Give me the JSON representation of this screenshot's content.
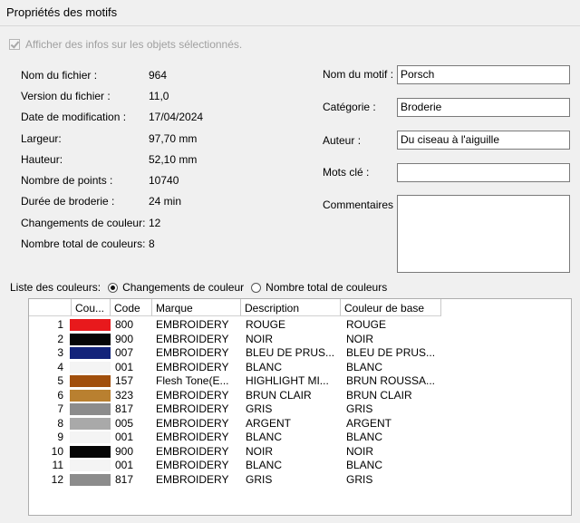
{
  "window": {
    "title": "Propriétés des motifs"
  },
  "show_info_checkbox": {
    "label": "Afficher des infos sur les objets sélectionnés.",
    "checked": true,
    "enabled": false
  },
  "info": [
    {
      "label": "Nom du fichier :",
      "value": "964"
    },
    {
      "label": "Version du fichier :",
      "value": "11,0"
    },
    {
      "label": "Date de modification :",
      "value": "17/04/2024"
    },
    {
      "label": "Largeur:",
      "value": "97,70 mm"
    },
    {
      "label": "Hauteur:",
      "value": "52,10 mm"
    },
    {
      "label": "Nombre de points :",
      "value": "10740"
    },
    {
      "label": "Durée de broderie :",
      "value": "24 min"
    },
    {
      "label": "Changements de couleur:",
      "value": "12"
    },
    {
      "label": "Nombre total de couleurs:",
      "value": "8"
    }
  ],
  "fields": {
    "name": {
      "label": "Nom du motif :",
      "value": "Porsch"
    },
    "category": {
      "label": "Catégorie :",
      "value": "Broderie"
    },
    "author": {
      "label": "Auteur :",
      "value": "Du ciseau à l'aiguille"
    },
    "keywords": {
      "label": "Mots clé :",
      "value": ""
    },
    "comments": {
      "label": "Commentaires :",
      "value": ""
    }
  },
  "color_list": {
    "label": "Liste des couleurs:",
    "option_changes": "Changements de couleur",
    "option_total": "Nombre total de couleurs",
    "selected": "Changements de couleur"
  },
  "table": {
    "headers": [
      "Cou...",
      "Code",
      "Marque",
      "Description",
      "Couleur de base"
    ],
    "rows": [
      {
        "n": "1",
        "color": "#e8191c",
        "code": "800",
        "brand": "EMBROIDERY",
        "desc": "ROUGE",
        "base": "ROUGE"
      },
      {
        "n": "2",
        "color": "#060606",
        "code": "900",
        "brand": "EMBROIDERY",
        "desc": "NOIR",
        "base": "NOIR"
      },
      {
        "n": "3",
        "color": "#13237a",
        "code": "007",
        "brand": "EMBROIDERY",
        "desc": "BLEU DE PRUS...",
        "base": "BLEU DE PRUS..."
      },
      {
        "n": "4",
        "color": "#f4f4f4",
        "code": "001",
        "brand": "EMBROIDERY",
        "desc": "BLANC",
        "base": "BLANC"
      },
      {
        "n": "5",
        "color": "#a14f0c",
        "code": "157",
        "brand": "Flesh Tone(E...",
        "desc": "HIGHLIGHT MI...",
        "base": "BRUN ROUSSA..."
      },
      {
        "n": "6",
        "color": "#b98030",
        "code": "323",
        "brand": "EMBROIDERY",
        "desc": "BRUN CLAIR",
        "base": "BRUN CLAIR"
      },
      {
        "n": "7",
        "color": "#8c8c8c",
        "code": "817",
        "brand": "EMBROIDERY",
        "desc": "GRIS",
        "base": "GRIS"
      },
      {
        "n": "8",
        "color": "#a9a9a9",
        "code": "005",
        "brand": "EMBROIDERY",
        "desc": "ARGENT",
        "base": "ARGENT"
      },
      {
        "n": "9",
        "color": "#f4f4f4",
        "code": "001",
        "brand": "EMBROIDERY",
        "desc": "BLANC",
        "base": "BLANC"
      },
      {
        "n": "10",
        "color": "#060606",
        "code": "900",
        "brand": "EMBROIDERY",
        "desc": "NOIR",
        "base": "NOIR"
      },
      {
        "n": "11",
        "color": "#f4f4f4",
        "code": "001",
        "brand": "EMBROIDERY",
        "desc": "BLANC",
        "base": "BLANC"
      },
      {
        "n": "12",
        "color": "#8c8c8c",
        "code": "817",
        "brand": "EMBROIDERY",
        "desc": "GRIS",
        "base": "GRIS"
      }
    ]
  }
}
